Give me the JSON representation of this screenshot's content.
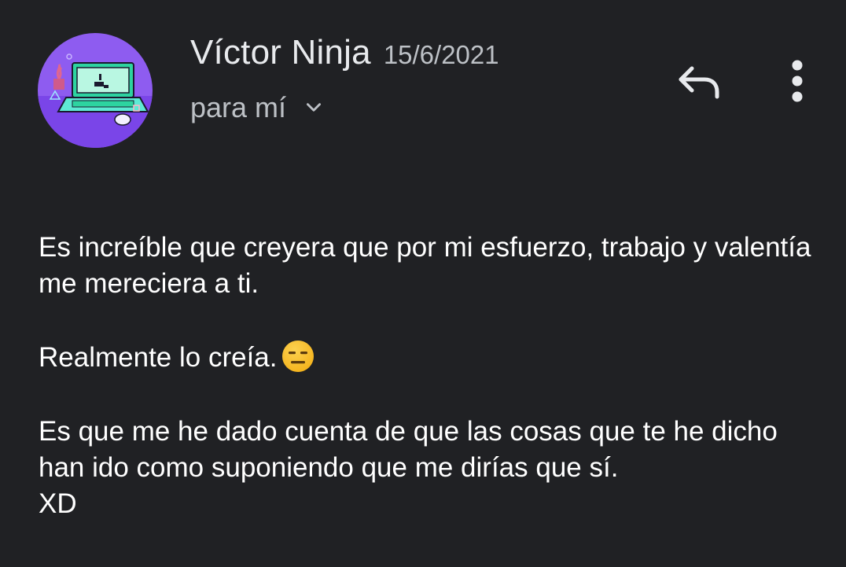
{
  "header": {
    "sender_name": "Víctor Ninja",
    "date": "15/6/2021",
    "recipient": "para mí",
    "avatar_icon": "laptop-illustration-icon",
    "reply_icon": "reply-icon",
    "more_icon": "more-vertical-icon",
    "expand_icon": "chevron-down-icon"
  },
  "message": {
    "paragraph_1": "Es increíble que creyera que por mi esfuerzo, trabajo y valentía me mereciera a ti.",
    "paragraph_2": "Realmente lo creía.",
    "paragraph_2_emoji": "expressionless-face-emoji",
    "paragraph_3_line_1": "Es que me he dado cuenta de que las cosas que te he dicho han ido como suponiendo que me dirías que sí.",
    "paragraph_3_line_2": "XD"
  },
  "colors": {
    "background": "#202124",
    "text_primary": "#e8eaed",
    "text_secondary": "#bdc1c6",
    "avatar_purple": "#8b5cf6"
  }
}
